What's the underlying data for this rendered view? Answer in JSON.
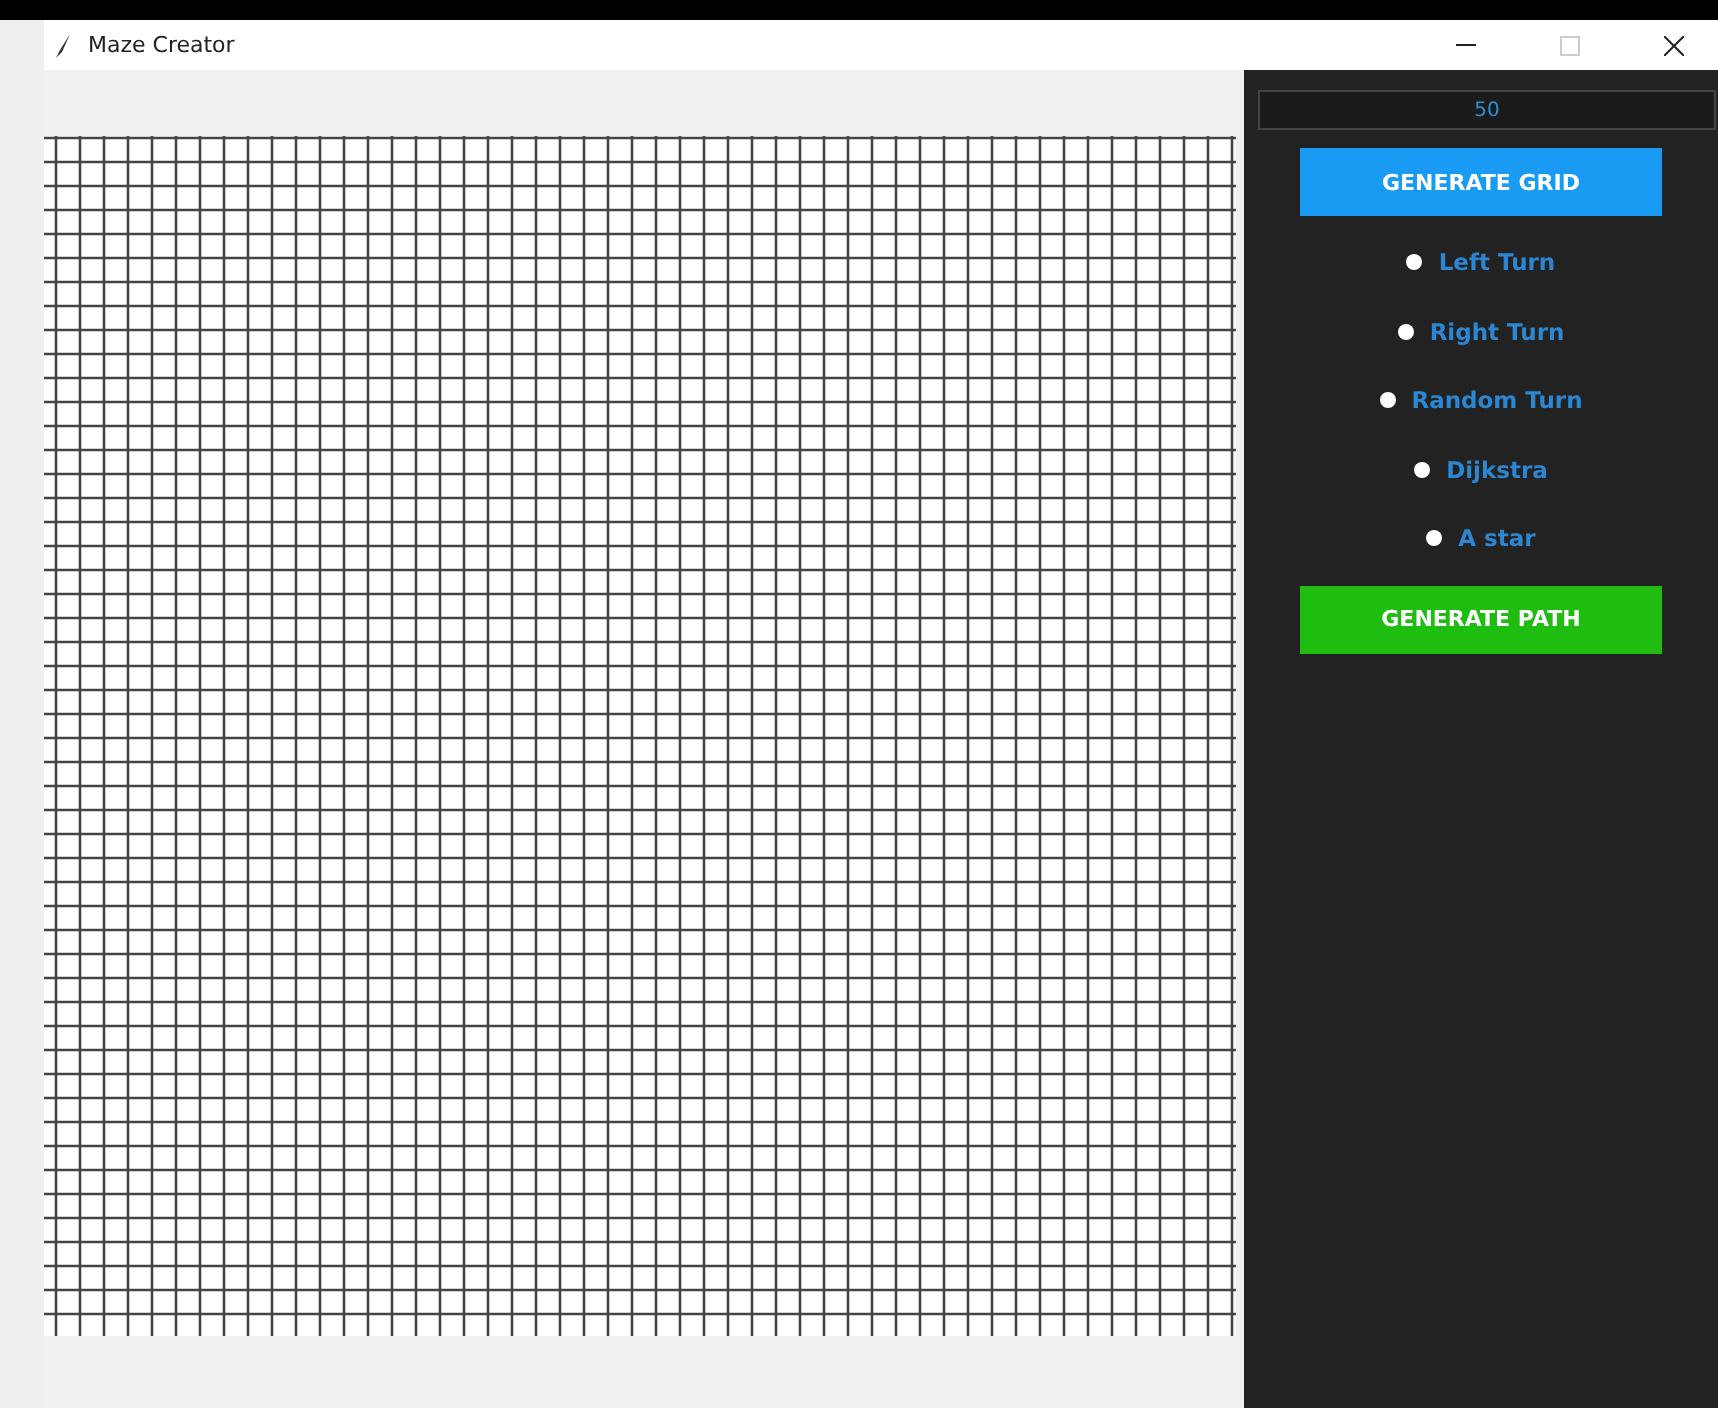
{
  "window": {
    "title": "Maze Creator"
  },
  "grid": {
    "size_field": "50"
  },
  "buttons": [
    {
      "label": "GENERATE GRID",
      "kind": "grid"
    },
    {
      "label": "GENERATE PATH",
      "kind": "path"
    }
  ],
  "algorithms": [
    {
      "label": "Left Turn",
      "selected": false
    },
    {
      "label": "Right Turn",
      "selected": false
    },
    {
      "label": "Random Turn",
      "selected": false
    },
    {
      "label": "Dijkstra",
      "selected": false
    },
    {
      "label": "A star",
      "selected": false
    }
  ]
}
